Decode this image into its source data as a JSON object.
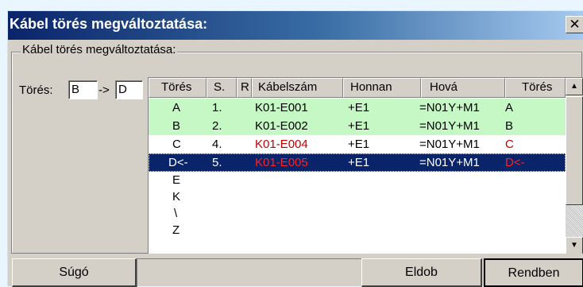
{
  "window": {
    "title": "Kábel törés megváltoztatása:",
    "close_glyph": "✕"
  },
  "group": {
    "label": "Kábel törés megváltoztatása:"
  },
  "tores": {
    "label": "Törés:",
    "from_value": "B",
    "arrow": "->",
    "to_value": "D"
  },
  "table": {
    "columns": [
      "Törés",
      "S.",
      "R",
      "Kábelszám",
      "Honnan",
      "Hová",
      "Törés"
    ],
    "rows": [
      {
        "tores": "A",
        "s": "1.",
        "r": "",
        "kabelszam": "K01-E001",
        "honnan": "+E1",
        "hova": "=N01Y+M1",
        "tores2": "A",
        "state": "ok"
      },
      {
        "tores": "B",
        "s": "2.",
        "r": "",
        "kabelszam": "K01-E002",
        "honnan": "+E1",
        "hova": "=N01Y+M1",
        "tores2": "B",
        "state": "ok"
      },
      {
        "tores": "C",
        "s": "4.",
        "r": "",
        "kabelszam": "K01-E004",
        "honnan": "+E1",
        "hova": "=N01Y+M1",
        "tores2": "C",
        "state": "changed"
      },
      {
        "tores": "D<-",
        "s": "5.",
        "r": "",
        "kabelszam": "K01-E005",
        "honnan": "+E1",
        "hova": "=N01Y+M1",
        "tores2": "D<-",
        "state": "selected"
      }
    ],
    "extra_tores": [
      "E",
      "K",
      "\\",
      "Z"
    ]
  },
  "scrollbar": {
    "up_glyph": "▲",
    "down_glyph": "▼"
  },
  "buttons": {
    "help": "Súgó",
    "discard": "Eldob",
    "ok": "Rendben"
  },
  "colors": {
    "title_gradient_start": "#0a246a",
    "title_gradient_end": "#a6caf0",
    "row_ok": "#c6f8c6",
    "row_selected": "#0a246a",
    "changed_text": "#c00000"
  }
}
